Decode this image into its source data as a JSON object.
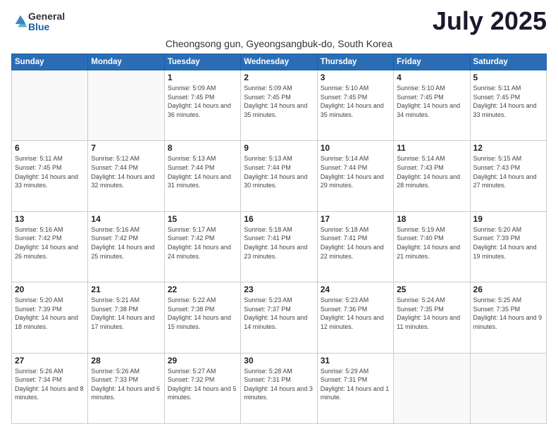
{
  "logo": {
    "general": "General",
    "blue": "Blue"
  },
  "title": "July 2025",
  "subtitle": "Cheongsong gun, Gyeongsangbuk-do, South Korea",
  "header_days": [
    "Sunday",
    "Monday",
    "Tuesday",
    "Wednesday",
    "Thursday",
    "Friday",
    "Saturday"
  ],
  "weeks": [
    [
      {
        "day": "",
        "info": ""
      },
      {
        "day": "",
        "info": ""
      },
      {
        "day": "1",
        "info": "Sunrise: 5:09 AM\nSunset: 7:45 PM\nDaylight: 14 hours and 36 minutes."
      },
      {
        "day": "2",
        "info": "Sunrise: 5:09 AM\nSunset: 7:45 PM\nDaylight: 14 hours and 35 minutes."
      },
      {
        "day": "3",
        "info": "Sunrise: 5:10 AM\nSunset: 7:45 PM\nDaylight: 14 hours and 35 minutes."
      },
      {
        "day": "4",
        "info": "Sunrise: 5:10 AM\nSunset: 7:45 PM\nDaylight: 14 hours and 34 minutes."
      },
      {
        "day": "5",
        "info": "Sunrise: 5:11 AM\nSunset: 7:45 PM\nDaylight: 14 hours and 33 minutes."
      }
    ],
    [
      {
        "day": "6",
        "info": "Sunrise: 5:11 AM\nSunset: 7:45 PM\nDaylight: 14 hours and 33 minutes."
      },
      {
        "day": "7",
        "info": "Sunrise: 5:12 AM\nSunset: 7:44 PM\nDaylight: 14 hours and 32 minutes."
      },
      {
        "day": "8",
        "info": "Sunrise: 5:13 AM\nSunset: 7:44 PM\nDaylight: 14 hours and 31 minutes."
      },
      {
        "day": "9",
        "info": "Sunrise: 5:13 AM\nSunset: 7:44 PM\nDaylight: 14 hours and 30 minutes."
      },
      {
        "day": "10",
        "info": "Sunrise: 5:14 AM\nSunset: 7:44 PM\nDaylight: 14 hours and 29 minutes."
      },
      {
        "day": "11",
        "info": "Sunrise: 5:14 AM\nSunset: 7:43 PM\nDaylight: 14 hours and 28 minutes."
      },
      {
        "day": "12",
        "info": "Sunrise: 5:15 AM\nSunset: 7:43 PM\nDaylight: 14 hours and 27 minutes."
      }
    ],
    [
      {
        "day": "13",
        "info": "Sunrise: 5:16 AM\nSunset: 7:42 PM\nDaylight: 14 hours and 26 minutes."
      },
      {
        "day": "14",
        "info": "Sunrise: 5:16 AM\nSunset: 7:42 PM\nDaylight: 14 hours and 25 minutes."
      },
      {
        "day": "15",
        "info": "Sunrise: 5:17 AM\nSunset: 7:42 PM\nDaylight: 14 hours and 24 minutes."
      },
      {
        "day": "16",
        "info": "Sunrise: 5:18 AM\nSunset: 7:41 PM\nDaylight: 14 hours and 23 minutes."
      },
      {
        "day": "17",
        "info": "Sunrise: 5:18 AM\nSunset: 7:41 PM\nDaylight: 14 hours and 22 minutes."
      },
      {
        "day": "18",
        "info": "Sunrise: 5:19 AM\nSunset: 7:40 PM\nDaylight: 14 hours and 21 minutes."
      },
      {
        "day": "19",
        "info": "Sunrise: 5:20 AM\nSunset: 7:39 PM\nDaylight: 14 hours and 19 minutes."
      }
    ],
    [
      {
        "day": "20",
        "info": "Sunrise: 5:20 AM\nSunset: 7:39 PM\nDaylight: 14 hours and 18 minutes."
      },
      {
        "day": "21",
        "info": "Sunrise: 5:21 AM\nSunset: 7:38 PM\nDaylight: 14 hours and 17 minutes."
      },
      {
        "day": "22",
        "info": "Sunrise: 5:22 AM\nSunset: 7:38 PM\nDaylight: 14 hours and 15 minutes."
      },
      {
        "day": "23",
        "info": "Sunrise: 5:23 AM\nSunset: 7:37 PM\nDaylight: 14 hours and 14 minutes."
      },
      {
        "day": "24",
        "info": "Sunrise: 5:23 AM\nSunset: 7:36 PM\nDaylight: 14 hours and 12 minutes."
      },
      {
        "day": "25",
        "info": "Sunrise: 5:24 AM\nSunset: 7:35 PM\nDaylight: 14 hours and 11 minutes."
      },
      {
        "day": "26",
        "info": "Sunrise: 5:25 AM\nSunset: 7:35 PM\nDaylight: 14 hours and 9 minutes."
      }
    ],
    [
      {
        "day": "27",
        "info": "Sunrise: 5:26 AM\nSunset: 7:34 PM\nDaylight: 14 hours and 8 minutes."
      },
      {
        "day": "28",
        "info": "Sunrise: 5:26 AM\nSunset: 7:33 PM\nDaylight: 14 hours and 6 minutes."
      },
      {
        "day": "29",
        "info": "Sunrise: 5:27 AM\nSunset: 7:32 PM\nDaylight: 14 hours and 5 minutes."
      },
      {
        "day": "30",
        "info": "Sunrise: 5:28 AM\nSunset: 7:31 PM\nDaylight: 14 hours and 3 minutes."
      },
      {
        "day": "31",
        "info": "Sunrise: 5:29 AM\nSunset: 7:31 PM\nDaylight: 14 hours and 1 minute."
      },
      {
        "day": "",
        "info": ""
      },
      {
        "day": "",
        "info": ""
      }
    ]
  ]
}
